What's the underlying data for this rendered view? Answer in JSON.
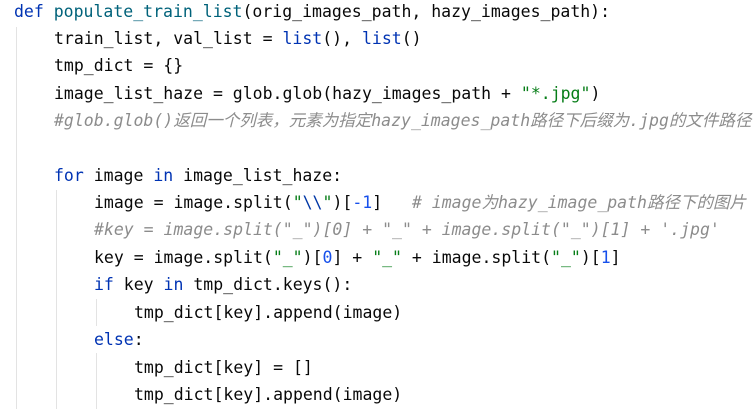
{
  "code": {
    "line1": {
      "kw": "def",
      "fn": "populate_train_list",
      "rest": "(orig_images_path, hazy_images_path):"
    },
    "line2": {
      "a": "train_list, val_list = ",
      "b": "list",
      "c": "(), ",
      "d": "list",
      "e": "()"
    },
    "line3": {
      "a": "tmp_dict = {}"
    },
    "line4": {
      "a": "image_list_haze = glob.glob(hazy_images_path + ",
      "str": "\"*.jpg\"",
      "end": ")"
    },
    "line5": {
      "cmt": "#glob.glob()返回一个列表，元素为指定hazy_images_path路径下后缀为.jpg的文件路径"
    },
    "line7": {
      "kw1": "for",
      "a": " image ",
      "kw2": "in",
      "b": " image_list_haze:"
    },
    "line8": {
      "a": "image = image.split(",
      "s1": "\"",
      "esc": "\\\\",
      "s2": "\"",
      "b": ")[",
      "num": "-1",
      "c": "]   ",
      "cmt": "# image为hazy_image_path路径下的图片"
    },
    "line9": {
      "cmt": "#key = image.split(\"_\")[0] + \"_\" + image.split(\"_\")[1] + '.jpg'"
    },
    "line10": {
      "a": "key = image.split(",
      "s1": "\"_\"",
      "b": ")[",
      "n1": "0",
      "c": "] + ",
      "s2": "\"_\"",
      "d": " + image.split(",
      "s3": "\"_\"",
      "e": ")[",
      "n2": "1",
      "f": "]"
    },
    "line11": {
      "kw1": "if",
      "a": " key ",
      "kw2": "in",
      "b": " tmp_dict.keys():"
    },
    "line12": {
      "a": "tmp_dict[key].append(image)"
    },
    "line13": {
      "kw": "else",
      "a": ":"
    },
    "line14": {
      "a": "tmp_dict[key] = []"
    },
    "line15": {
      "a": "tmp_dict[key].append(image)"
    }
  },
  "colors": {
    "keyword": "#0033b3",
    "function": "#00627a",
    "string": "#067d17",
    "number": "#1750eb",
    "comment": "#8c8c8c",
    "background": "#ffffff"
  }
}
